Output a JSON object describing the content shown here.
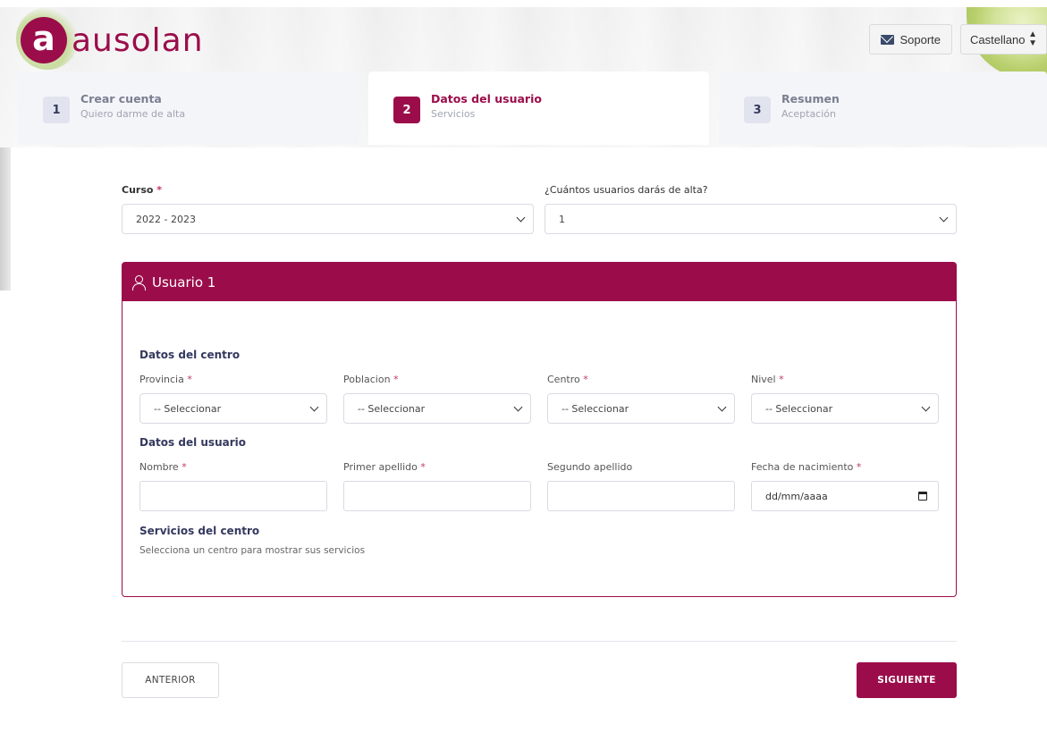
{
  "brand": {
    "logo_mark": "a",
    "logo_text": "ausolan"
  },
  "top": {
    "support_label": "Soporte",
    "language_value": "Castellano"
  },
  "steps": [
    {
      "num": "1",
      "title": "Crear cuenta",
      "subtitle": "Quiero darme de alta"
    },
    {
      "num": "2",
      "title": "Datos del usuario",
      "subtitle": "Servicios"
    },
    {
      "num": "3",
      "title": "Resumen",
      "subtitle": "Aceptación"
    }
  ],
  "form": {
    "curso_label": "Curso",
    "curso_value": "2022 - 2023",
    "usuarios_label": "¿Cuántos usuarios darás de alta?",
    "usuarios_value": "1",
    "required_mark": "*"
  },
  "card": {
    "title": "Usuario 1",
    "centro_section": "Datos del centro",
    "provincia_label": "Provincia",
    "poblacion_label": "Poblacion",
    "centro_label": "Centro",
    "nivel_label": "Nivel",
    "select_placeholder": "-- Seleccionar",
    "usuario_section": "Datos del usuario",
    "nombre_label": "Nombre",
    "apellido1_label": "Primer apellido",
    "apellido2_label": "Segundo apellido",
    "fecha_label": "Fecha de nacimiento",
    "fecha_placeholder": "dd/mm/aaaa",
    "servicios_section": "Servicios del centro",
    "servicios_help": "Selecciona un centro para mostrar sus servicios"
  },
  "nav": {
    "prev_label": "ANTERIOR",
    "next_label": "SIGUIENTE"
  },
  "colors": {
    "accent": "#9b0d4a",
    "step_bg": "#f4f5f8",
    "border": "#d9dbe3"
  },
  "icons": {
    "support": "envelope-icon",
    "user": "user-icon",
    "date": "calendar-icon",
    "select": "chevron-down-icon"
  }
}
